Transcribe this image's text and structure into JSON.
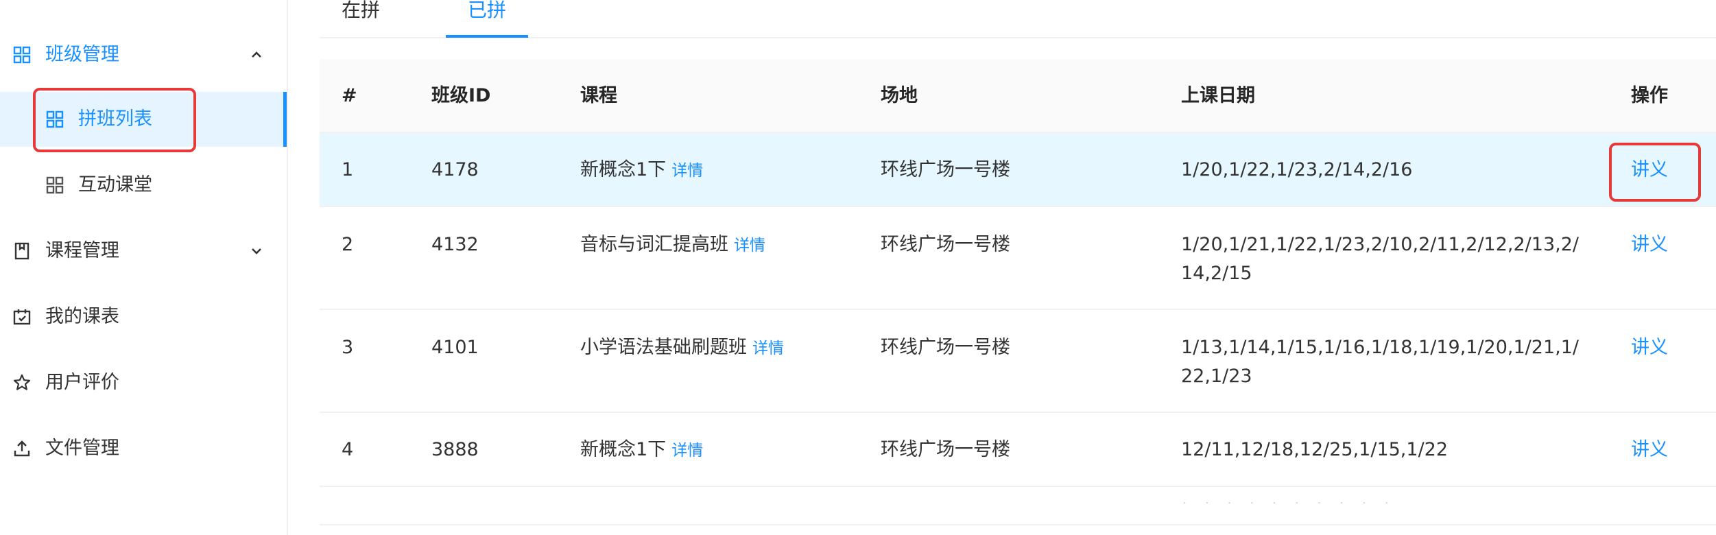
{
  "sidebar": {
    "class_management": {
      "label": "班级管理",
      "icon": "grid-icon",
      "expanded": true
    },
    "sub_items": [
      {
        "label": "拼班列表",
        "icon": "grid-icon",
        "selected": true
      },
      {
        "label": "互动课堂",
        "icon": "grid-icon",
        "selected": false
      }
    ],
    "items": [
      {
        "label": "课程管理",
        "icon": "book-icon",
        "has_chevron": true
      },
      {
        "label": "我的课表",
        "icon": "calendar-icon",
        "has_chevron": false
      },
      {
        "label": "用户评价",
        "icon": "star-icon",
        "has_chevron": false
      },
      {
        "label": "文件管理",
        "icon": "upload-icon",
        "has_chevron": false
      }
    ]
  },
  "tabs": [
    {
      "label": "在拼",
      "active": false
    },
    {
      "label": "已拼",
      "active": true
    }
  ],
  "table": {
    "columns": [
      "#",
      "班级ID",
      "课程",
      "场地",
      "上课日期",
      "操作"
    ],
    "rows": [
      {
        "index": "1",
        "class_id": "4178",
        "course": "新概念1下",
        "detail": "详情",
        "venue": "环线广场一号楼",
        "dates": "1/20,1/22,1/23,2/14,2/16",
        "action": "讲义"
      },
      {
        "index": "2",
        "class_id": "4132",
        "course": "音标与词汇提高班",
        "detail": "详情",
        "venue": "环线广场一号楼",
        "dates": "1/20,1/21,1/22,1/23,2/10,2/11,2/12,2/13,2/14,2/15",
        "action": "讲义"
      },
      {
        "index": "3",
        "class_id": "4101",
        "course": "小学语法基础刷题班",
        "detail": "详情",
        "venue": "环线广场一号楼",
        "dates": "1/13,1/14,1/15,1/16,1/18,1/19,1/20,1/21,1/22,1/23",
        "action": "讲义"
      },
      {
        "index": "4",
        "class_id": "3888",
        "course": "新概念1下",
        "detail": "详情",
        "venue": "环线广场一号楼",
        "dates": "12/11,12/18,12/25,1/15,1/22",
        "action": "讲义"
      }
    ]
  },
  "colors": {
    "accent": "#1890ff",
    "highlight_row": "#e6f7ff",
    "annotation_red": "#e5393a"
  }
}
